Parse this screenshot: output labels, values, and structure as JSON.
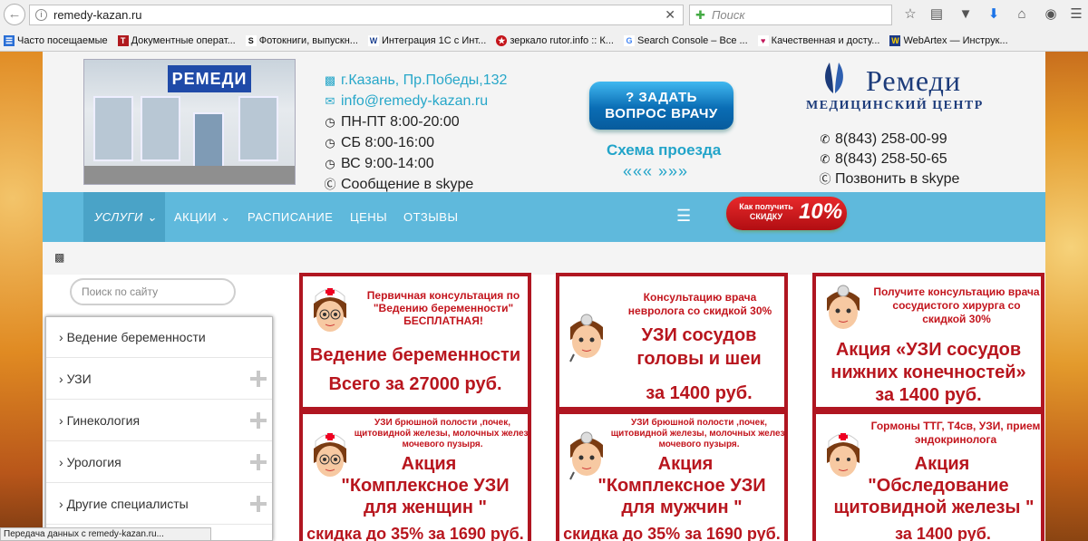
{
  "browser": {
    "url": "remedy-kazan.ru",
    "search_placeholder": "Поиск",
    "bookmarks": [
      "Часто посещаемые",
      "Документные операт...",
      "Фотокниги, выпускн...",
      "Интеграция 1С с Инт...",
      "зеркало rutor.info :: К...",
      "Search Console – Все ...",
      "Качественная и досту...",
      "WebArtex — Инструк..."
    ],
    "status_text": "Передача данных с remedy-kazan.ru..."
  },
  "header": {
    "address": "г.Казань, Пр.Победы,132",
    "email": "info@remedy-kazan.ru",
    "hours_weekdays": "ПН-ПТ 8:00-20:00",
    "hours_saturday": "СБ 8:00-16:00",
    "hours_sunday": "ВС 9:00-14:00",
    "skype_message": "Сообщение в skype",
    "photo_sign": "РЕМЕДИ",
    "ask_button_line1": "? ЗАДАТЬ",
    "ask_button_line2": "ВОПРОС ВРАЧУ",
    "route_label": "Схема проезда",
    "route_arrows": "«««  »»»",
    "logo_name": "Ремеди",
    "logo_subtitle": "МЕДИЦИНСКИЙ ЦЕНТР",
    "phone1": "8(843) 258-00-99",
    "phone2": "8(843) 258-50-65",
    "skype_call": "Позвонить в skype"
  },
  "menu": {
    "items": [
      "УСЛУГИ",
      "АКЦИИ",
      "РАСПИСАНИЕ",
      "ЦЕНЫ",
      "ОТЗЫВЫ"
    ],
    "discount_text_line1": "Как получить",
    "discount_text_line2": "СКИДКУ",
    "discount_percent": "10%"
  },
  "sidebar": {
    "search_placeholder": "Поиск по сайту",
    "items": [
      "Ведение беременности",
      "УЗИ",
      "Гинекология",
      "Урология",
      "Другие специалисты"
    ]
  },
  "cards": [
    {
      "small": "Первичная консультация по \"Ведению беременности\" БЕСПЛАТНАЯ!",
      "big1": "Ведение беременности",
      "big2": "Всего за 27000 руб."
    },
    {
      "small": "Консультацию врача невролога со скидкой 30%",
      "big1": "УЗИ сосудов",
      "big2": "головы и шеи",
      "big3": "за 1400 руб."
    },
    {
      "small": "Получите консультацию врача сосудистого хирурга со скидкой 30%",
      "big1": "Акция «УЗИ сосудов",
      "big2": "нижних конечностей»",
      "big3": "за 1400 руб."
    },
    {
      "small": "УЗИ брюшной полости ,почек, щитовидной железы, молочных желез, мочевого пузыря.",
      "big1": "Акция",
      "big2": "\"Комплексное УЗИ",
      "big3": "для женщин \"",
      "big4": "скидка до 35% за 1690 руб."
    },
    {
      "small": "УЗИ брюшной полости ,почек, щитовидной железы, молочных желез, мочевого пузыря.",
      "big1": "Акция",
      "big2": "\"Комплексное УЗИ",
      "big3": "для мужчин \"",
      "big4": "скидка до 35% за 1690 руб."
    },
    {
      "small": "Гормоны ТТГ, Т4св, УЗИ, прием эндокринолога",
      "big1": "Акция",
      "big2": "\"Обследование",
      "big3": "щитовидной железы \"",
      "big4": "за 1400 руб."
    }
  ],
  "colors": {
    "accent_teal": "#27a7c9",
    "menu_blue": "#5fb9dc",
    "promo_red": "#b01621",
    "logo_blue": "#1c3b7a"
  }
}
